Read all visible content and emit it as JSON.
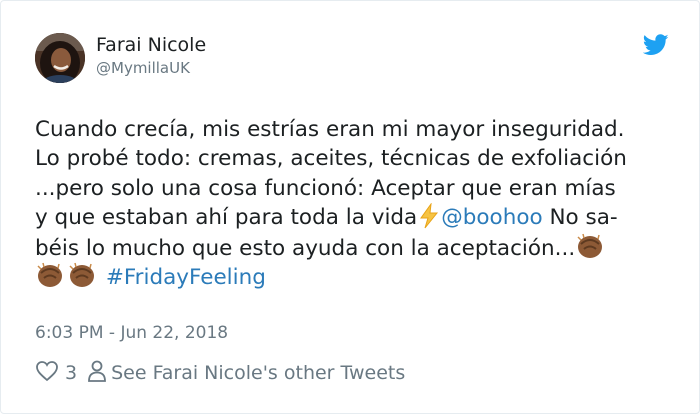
{
  "author": {
    "name": "Farai Nicole",
    "handle": "@MymillaUK",
    "avatar_icon": "avatar-photo"
  },
  "brand_icon": "twitter-bird-icon",
  "colors": {
    "link": "#2b7bb9",
    "muted": "#697882",
    "twitter_blue": "#1da1f2"
  },
  "tweet": {
    "line1": "Cuando crecía, mis estrías eran mi mayor inseguridad.",
    "line2": "Lo probé todo: cremas, aceites, técnicas de exfoliación",
    "line3": "...pero solo una cosa funcionó: Aceptar que eran mías",
    "line4_text": "y que estaban ahí para toda la vida",
    "mention": "@boohoo",
    "line4_tail": "No sa-",
    "line5": "béis lo mucho que esto ayuda con la aceptación...",
    "hashtag": "#FridayFeeling",
    "emojis": [
      "high-voltage",
      "clapping-hands",
      "clapping-hands",
      "clapping-hands"
    ]
  },
  "timestamp": "6:03 PM - Jun 22, 2018",
  "actions": {
    "like_count": "3",
    "other_tweets": "See Farai Nicole's other Tweets"
  }
}
